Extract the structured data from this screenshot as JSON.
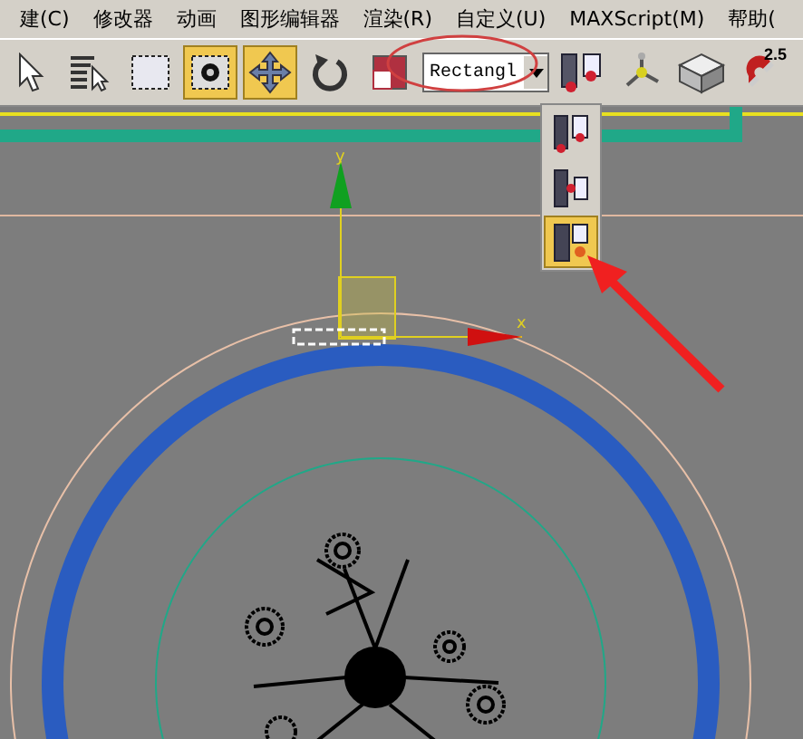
{
  "menu": [
    {
      "label": "建(C)"
    },
    {
      "label": "修改器"
    },
    {
      "label": "动画"
    },
    {
      "label": "图形编辑器"
    },
    {
      "label": "渲染(R)"
    },
    {
      "label": "自定义(U)"
    },
    {
      "label": "MAXScript(M)"
    },
    {
      "label": "帮助("
    }
  ],
  "toolbar": [
    {
      "kind": "select",
      "selected": false
    },
    {
      "kind": "select-list",
      "selected": false
    },
    {
      "kind": "region",
      "selected": false
    },
    {
      "kind": "crossing",
      "selected": true
    },
    {
      "kind": "move",
      "selected": true
    },
    {
      "kind": "rotate",
      "selected": false
    },
    {
      "kind": "scale",
      "selected": false
    },
    {
      "kind": "dropdown",
      "value": "Rectangl"
    },
    {
      "kind": "align",
      "selected": false
    },
    {
      "kind": "axis",
      "selected": false
    },
    {
      "kind": "render",
      "selected": false
    },
    {
      "kind": "snap",
      "label": "2.5",
      "selected": false
    }
  ],
  "flyout": [
    {
      "kind": "align-bottom",
      "selected": false
    },
    {
      "kind": "align-center",
      "selected": false
    },
    {
      "kind": "align-corner",
      "selected": true
    }
  ],
  "viewport": {
    "x_label": "x",
    "y_label": "y"
  }
}
